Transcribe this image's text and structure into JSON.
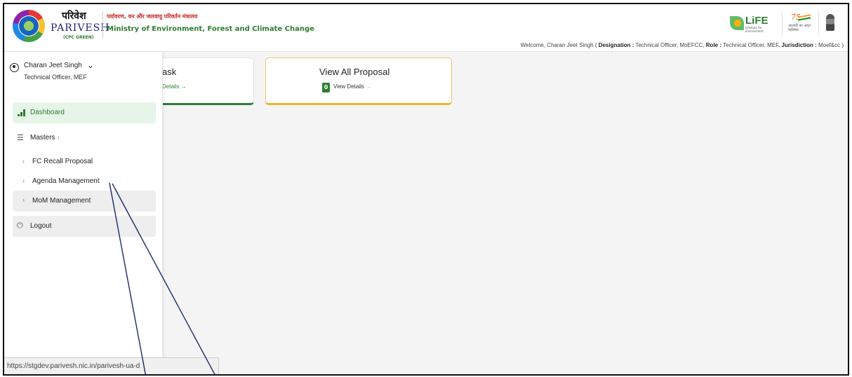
{
  "header": {
    "brand_hindi": "परिवेश",
    "brand_en": "PARIVESH",
    "brand_sub": "(CPC GREEN)",
    "ministry_hindi": "पर्यावरण, वन और जलवायु परिवर्तन मंत्रालय",
    "ministry_en": "Ministry of Environment, Forest and Climate Change",
    "life_logo_text": "LiFE",
    "life_logo_sub": "Lifestyle for Environment",
    "azadi_number": "75",
    "azadi_text": "आज़ादी का अमृत महोत्सव"
  },
  "welcome": {
    "prefix": "Welcome, Charan Jeet Singh ( ",
    "designation_label": "Designation :",
    "designation_value": " Technical Officer, MoEFCC, ",
    "role_label": "Role :",
    "role_value": " Technical Officer, MEF, ",
    "jurisdiction_label": "Jurisdiction :",
    "jurisdiction_value": " Moef&cc )"
  },
  "user": {
    "name": "Charan Jeet Singh",
    "role": "Technical Officer, MEF",
    "chevron": "⌄"
  },
  "sidebar": {
    "dashboard": "Dashboard",
    "masters": "Masters",
    "masters_chevron": "›",
    "fc_recall": "FC Recall Proposal",
    "agenda": "Agenda Management",
    "mom": "MoM Management",
    "logout": "Logout",
    "sub_chevron": "›",
    "list_icon": "☰",
    "power_icon": "⏻"
  },
  "cards": {
    "task_title": "ask",
    "task_link": "Details",
    "arrow": "→",
    "proposal_title": "View All Proposal",
    "proposal_count": "0",
    "proposal_link": "View Details"
  },
  "statusbar": {
    "url": "https://stgdev.parivesh.nic.in/parivesh-ua-d"
  },
  "colors": {
    "accent_green": "#2e7d32",
    "accent_yellow": "#f0b429",
    "annotation_line": "#1a2a6c"
  }
}
